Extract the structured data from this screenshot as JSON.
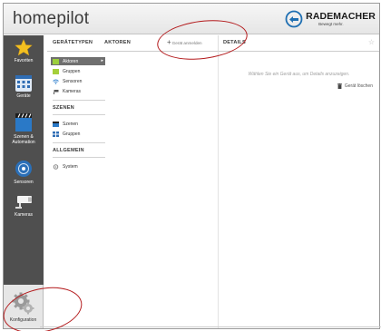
{
  "app": {
    "title": "homepilot"
  },
  "brand": {
    "name": "RADEMACHER",
    "tagline": "Bewegt mehr.",
    "accent": "#1f6fb2"
  },
  "sidebar": {
    "items": [
      {
        "label": "Favoriten",
        "icon": "star-icon"
      },
      {
        "label": "Geräte",
        "icon": "device-grid-icon"
      },
      {
        "label": "Szenen & Automation",
        "icon": "scene-icon"
      },
      {
        "label": "Sensoren",
        "icon": "sensor-icon"
      },
      {
        "label": "Kameras",
        "icon": "camera-icon"
      },
      {
        "label": "Konfiguration",
        "icon": "gear-icon"
      }
    ]
  },
  "column1": {
    "tabs": [
      "GERÄTETYPEN",
      "AKTOREN"
    ],
    "device_items": [
      {
        "label": "Aktoren",
        "icon": "actuator-icon",
        "selected": true
      },
      {
        "label": "Gruppen",
        "icon": "group-icon"
      },
      {
        "label": "Sensoren",
        "icon": "sensor-wifi-icon"
      },
      {
        "label": "Kameras",
        "icon": "camera-small-icon"
      }
    ],
    "scenes_header": "SZENEN",
    "scene_items": [
      {
        "label": "Szenen",
        "icon": "scene-small-icon"
      },
      {
        "label": "Gruppen",
        "icon": "group-grid-icon"
      }
    ],
    "general_header": "ALLGEMEIN",
    "general_items": [
      {
        "label": "System",
        "icon": "system-icon"
      }
    ]
  },
  "middle": {
    "add_device_label": "Gerät anmelden"
  },
  "details": {
    "title": "DETAILS",
    "hint": "Wählen Sie ein Gerät aus, um Details anzuzeigen.",
    "delete_label": "Gerät löschen"
  },
  "annotation_color": "#b3191b"
}
